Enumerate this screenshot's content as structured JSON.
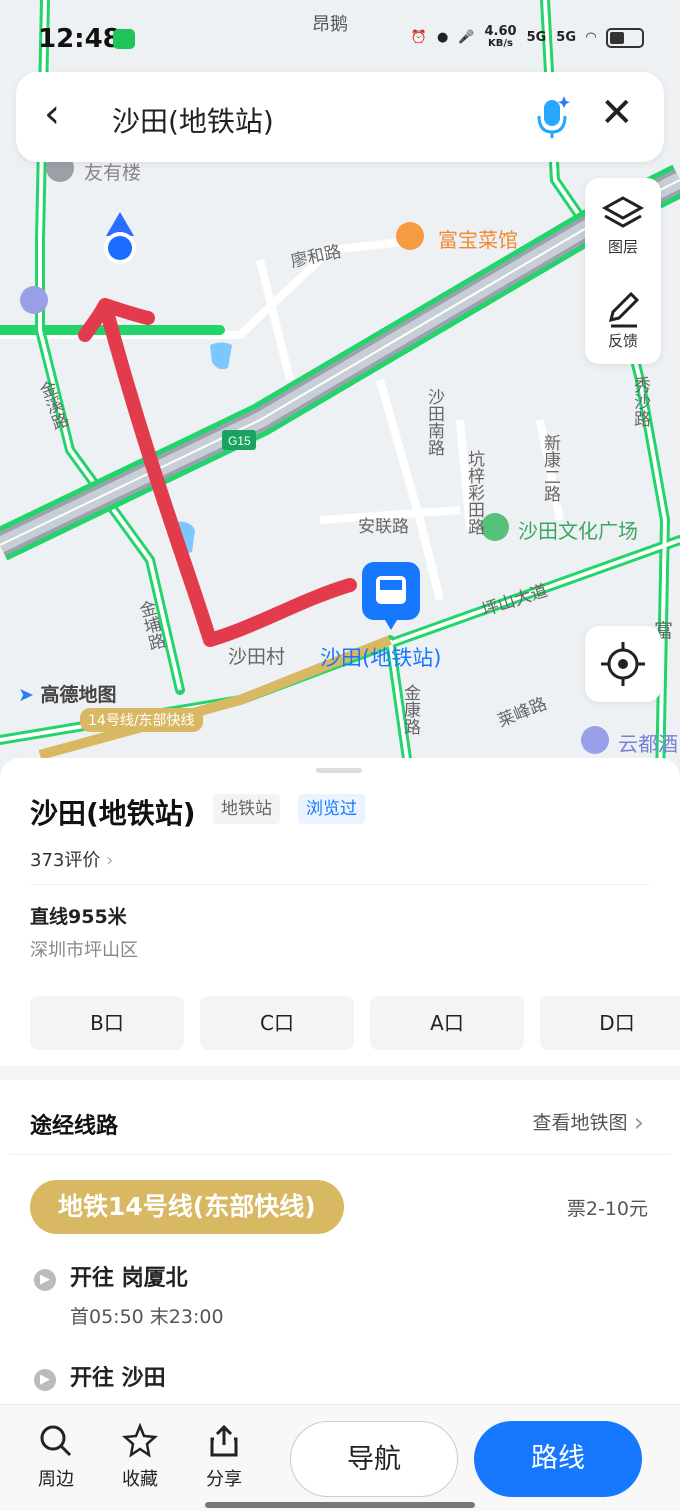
{
  "status_bar": {
    "time": "12:48",
    "top_place": "昂鹅",
    "net_speed": "4.60",
    "net_unit": "KB/s",
    "sig1": "5G",
    "sig2": "5G"
  },
  "search": {
    "query": "沙田(地铁站)"
  },
  "tools": {
    "layers_label": "图层",
    "feedback_label": "反馈"
  },
  "map": {
    "labels": {
      "youyoulou": "友有楼",
      "fubao": "富宝菜馆",
      "liaohe": "廖和路",
      "jinxi": "金溪路",
      "g15": "G15",
      "shatian_nan": "沙田南路",
      "kengzi": "坑梓彩田路",
      "xinkang": "新康二路",
      "anlian": "安联路",
      "culture": "沙田文化广场",
      "pingshan": "坪山大道",
      "jinpu": "金埔路",
      "shatian_cun": "沙田村",
      "station": "沙田(地铁站)",
      "jinkang": "金康路",
      "huifeng": "莱峰路",
      "yundu": "云都酒",
      "xiusha": "秀沙路",
      "logo": "高德地图",
      "line_tag": "14号线/东部快线",
      "fu": "富"
    }
  },
  "place": {
    "name": "沙田(地铁站)",
    "tag_type": "地铁站",
    "tag_viewed": "浏览过",
    "rating": "373评价",
    "distance": "直线955米",
    "district": "深圳市坪山区",
    "exits": [
      "B口",
      "C口",
      "A口",
      "D口"
    ]
  },
  "routes_section": {
    "title": "途经线路",
    "link": "查看地铁图",
    "line_name": "地铁14号线(东部快线)",
    "fare": "票2-10元",
    "directions": [
      {
        "label": "开往 岗厦北",
        "times": "首05:50  末23:00"
      },
      {
        "label": "开往 沙田"
      }
    ]
  },
  "bottom_bar": {
    "nearby": "周边",
    "favorite": "收藏",
    "share": "分享",
    "navigate": "导航",
    "route": "路线"
  },
  "colors": {
    "accent": "#1677ff",
    "line14": "#d8b862",
    "road": "#22d46a",
    "annotation": "#e23b4c"
  }
}
